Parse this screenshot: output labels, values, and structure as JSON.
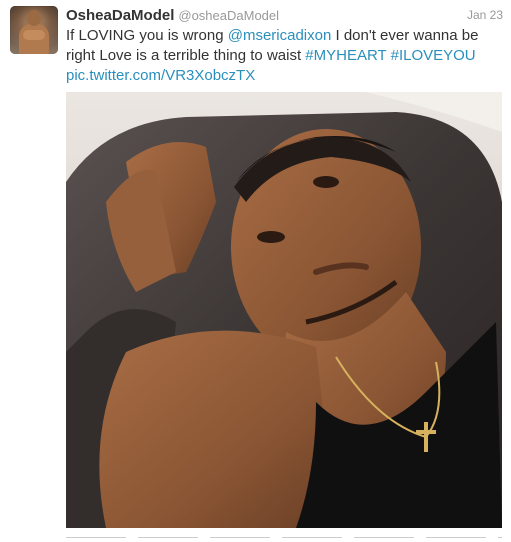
{
  "tweet": {
    "display_name": "OsheaDaModel",
    "handle": "@osheaDaModel",
    "date": "Jan 23",
    "text_part1": "If LOVING you is wrong ",
    "mention": "@msericadixon",
    "text_part2": " I don't ever wanna be right Love is a terrible thing to waist ",
    "hashtag1": "#MYHEART",
    "hashtag2": "#ILOVEYOU",
    "link": "pic.twitter.com/VR3XobczTX"
  },
  "colors": {
    "link": "#2a8fbd",
    "text": "#333333",
    "meta": "#999999"
  }
}
